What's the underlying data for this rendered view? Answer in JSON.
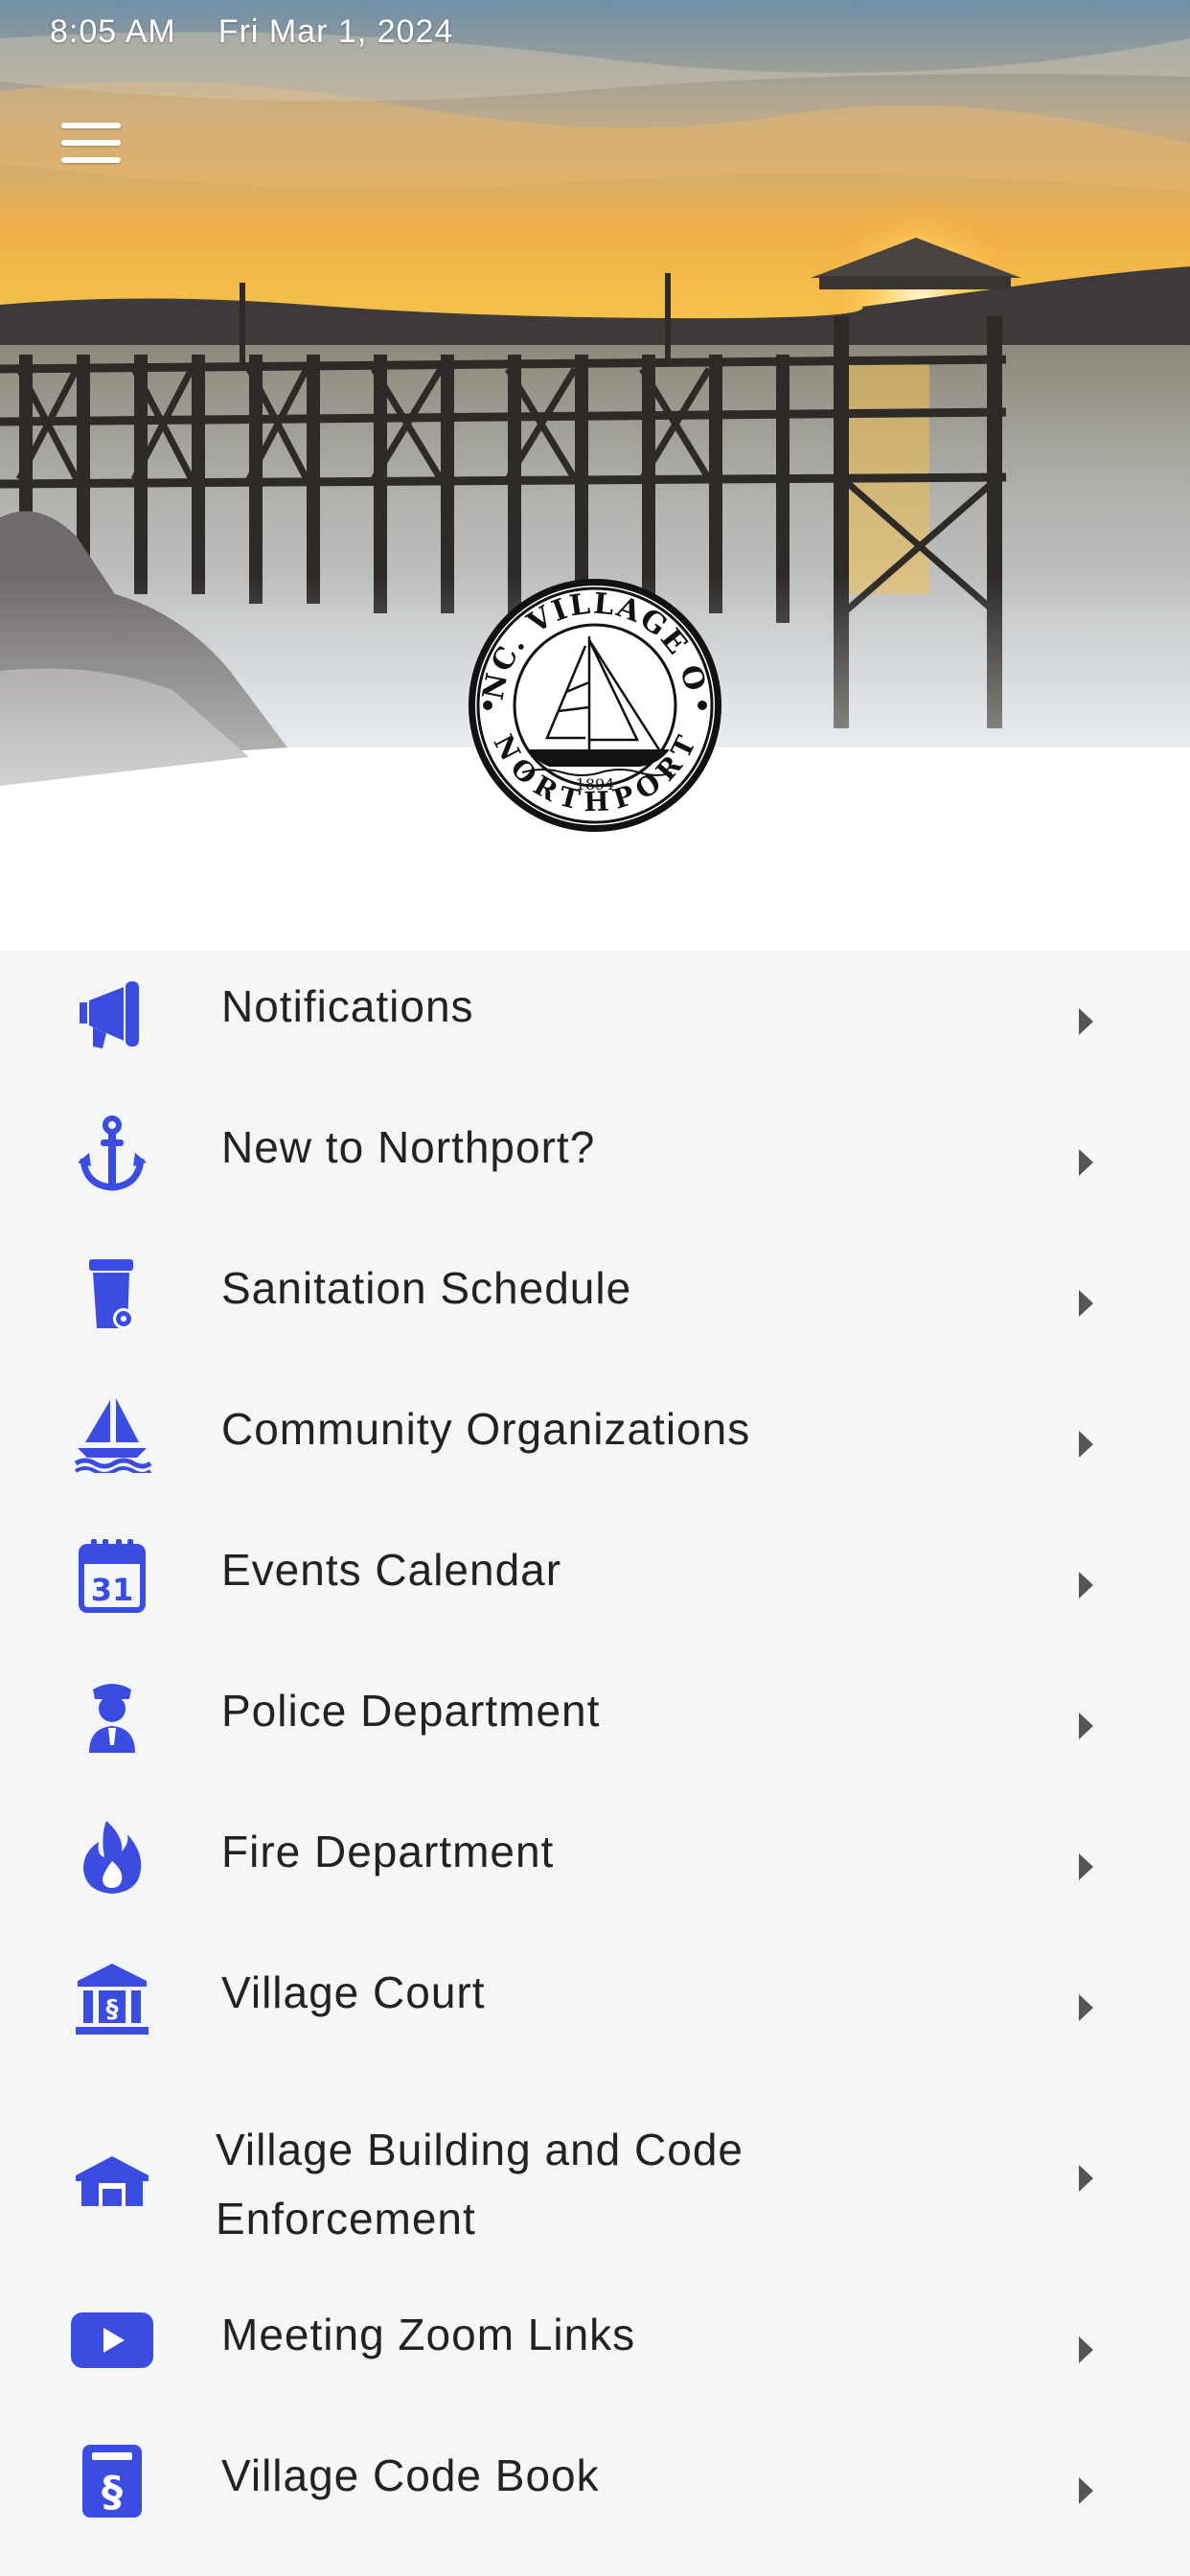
{
  "status_bar": {
    "time": "8:05 AM",
    "date": "Fri Mar 1, 2024"
  },
  "header": {
    "menu_icon": "hamburger-icon",
    "seal_text_top": "INC. VILLAGE OF",
    "seal_text_bottom": "NORTHPORT",
    "seal_year": "1894"
  },
  "colors": {
    "accent": "#3b4de0",
    "list_background": "#f5f6f8",
    "label_text": "#222222",
    "chevron": "#555555"
  },
  "menu": {
    "items": [
      {
        "label": "Notifications",
        "icon": "megaphone-icon"
      },
      {
        "label": "New to Northport?",
        "icon": "anchor-icon"
      },
      {
        "label": "Sanitation Schedule",
        "icon": "trash-bin-icon"
      },
      {
        "label": "Community Organizations",
        "icon": "sailboat-icon"
      },
      {
        "label": "Events Calendar",
        "icon": "calendar-icon"
      },
      {
        "label": "Police Department",
        "icon": "police-officer-icon"
      },
      {
        "label": "Fire Department",
        "icon": "fire-icon"
      },
      {
        "label": "Village Court",
        "icon": "courthouse-icon"
      },
      {
        "label": "Village Building and Code Enforcement",
        "icon": "building-icon"
      },
      {
        "label": "Meeting Zoom Links",
        "icon": "video-play-icon"
      },
      {
        "label": "Village Code Book",
        "icon": "code-book-icon"
      }
    ]
  }
}
